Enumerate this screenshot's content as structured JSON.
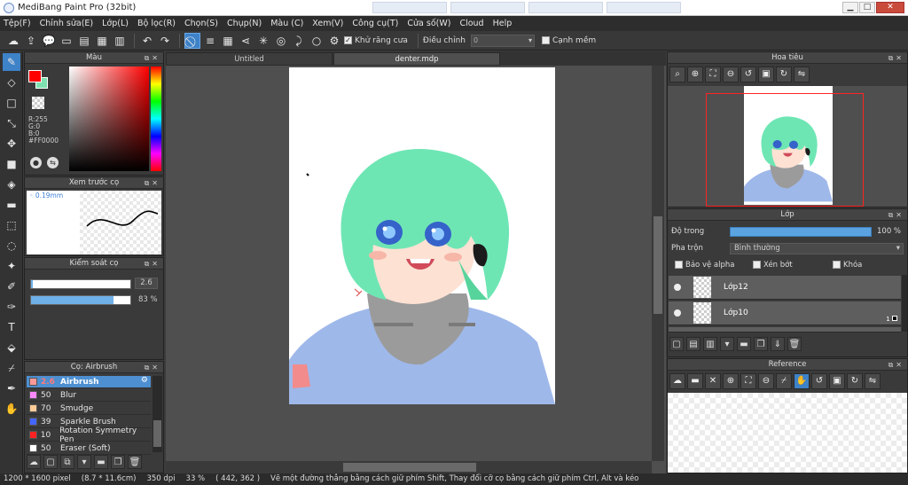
{
  "window": {
    "title": "MediBang Paint Pro (32bit)",
    "controls": [
      "▁",
      "□",
      "✕"
    ]
  },
  "menu": [
    "Tệp(F)",
    "Chỉnh sửa(E)",
    "Lớp(L)",
    "Bộ lọc(R)",
    "Chọn(S)",
    "Chụp(N)",
    "Màu (C)",
    "Xem(V)",
    "Công cụ(T)",
    "Cửa số(W)",
    "Cloud",
    "Help"
  ],
  "toolbar": {
    "antialias_label": "Khử răng cưa",
    "antialias_checked": true,
    "adjust_label": "Điều chỉnh",
    "adjust_value": "0",
    "sharp_edge_label": "Cạnh mềm",
    "sharp_edge_checked": false
  },
  "color_panel": {
    "title": "Màu",
    "foreground": "#FF0000",
    "background": "#7FE0B0",
    "r": "R:255",
    "g": "G:0",
    "b": "B:0",
    "hex": "#FF0000"
  },
  "brush_preview": {
    "title": "Xem trước cọ",
    "size_label": "0.19mm"
  },
  "brush_control": {
    "title": "Kiểm soát cọ",
    "size_value": "2.6",
    "size_fraction": 0.0,
    "opacity_value": "83 %",
    "opacity_fraction": 0.83
  },
  "brush_list": {
    "title": "Cọ: Airbrush",
    "items": [
      {
        "size": "2.6",
        "name": "Airbrush",
        "color": "#ff9999",
        "selected": true
      },
      {
        "size": "50",
        "name": "Blur",
        "color": "#ff88ff",
        "selected": false
      },
      {
        "size": "70",
        "name": "Smudge",
        "color": "#ffcc99",
        "selected": false
      },
      {
        "size": "39",
        "name": "Sparkle Brush",
        "color": "#4466ff",
        "selected": false
      },
      {
        "size": "10",
        "name": "Rotation Symmetry Pen",
        "color": "#ff2222",
        "selected": false
      },
      {
        "size": "50",
        "name": "Eraser (Soft)",
        "color": "#ffffff",
        "selected": false
      }
    ]
  },
  "documents": {
    "tabs": [
      {
        "label": "Untitled",
        "active": false
      },
      {
        "label": "denter.mdp",
        "active": true
      }
    ]
  },
  "navigator": {
    "title": "Hoa tiêu"
  },
  "layers": {
    "title": "Lớp",
    "opacity_label": "Độ trong",
    "opacity_value": "100 %",
    "opacity_fraction": 1.0,
    "blend_label": "Pha trộn",
    "blend_value": "Bình thường",
    "protect_alpha": "Bảo vệ alpha",
    "clip": "Xén bớt",
    "lock": "Khóa",
    "items": [
      {
        "name": "Lớp12"
      },
      {
        "name": "Lớp10",
        "badge": "1"
      }
    ]
  },
  "reference": {
    "title": "Reference"
  },
  "status": {
    "size": "1200 * 1600 pixel",
    "physical": "(8.7 * 11.6cm)",
    "dpi": "350 dpi",
    "zoom": "33 %",
    "coords": "( 442, 362 )",
    "hint": "Vẽ một đường thẳng bằng cách giữ phím Shift, Thay đổi cỡ cọ bằng cách giữ phím Ctrl, Alt và kéo"
  }
}
